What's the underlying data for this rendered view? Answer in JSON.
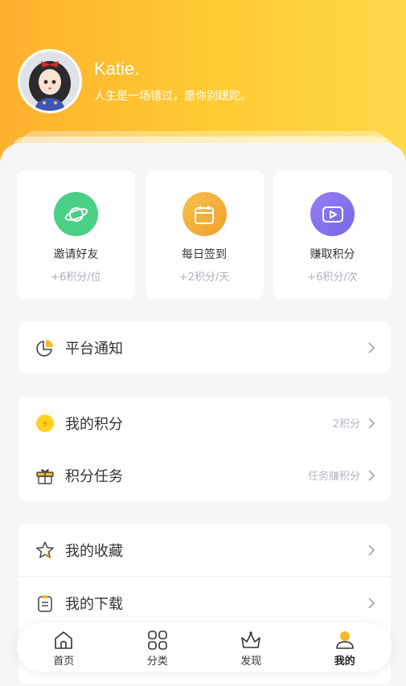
{
  "profile": {
    "name": "Katie.",
    "motto": "人生是一场错过，愿你别蹉跎。"
  },
  "actions": [
    {
      "label": "邀请好友",
      "sub": "+6积分/位",
      "color": "#49cf86",
      "icon": "planet-icon"
    },
    {
      "label": "每日签到",
      "sub": "+2积分/天",
      "color": "#f2b43c",
      "icon": "calendar-icon"
    },
    {
      "label": "赚取积分",
      "sub": "+6积分/次",
      "color": "#8a70ee",
      "icon": "video-icon"
    }
  ],
  "menu": {
    "notice": {
      "label": "平台通知"
    },
    "points": {
      "label": "我的积分",
      "extra": "2积分"
    },
    "tasks": {
      "label": "积分任务",
      "extra": "任务赚积分"
    },
    "favorites": {
      "label": "我的收藏"
    },
    "downloads": {
      "label": "我的下载"
    }
  },
  "tabbar": [
    {
      "label": "首页",
      "icon": "home-icon"
    },
    {
      "label": "分类",
      "icon": "grid-icon"
    },
    {
      "label": "发现",
      "icon": "crown-icon"
    },
    {
      "label": "我的",
      "icon": "user-icon",
      "active": true
    }
  ],
  "colors": {
    "header_start": "#ffb02e",
    "header_end": "#ffd84a",
    "accent": "#f5b82e"
  }
}
